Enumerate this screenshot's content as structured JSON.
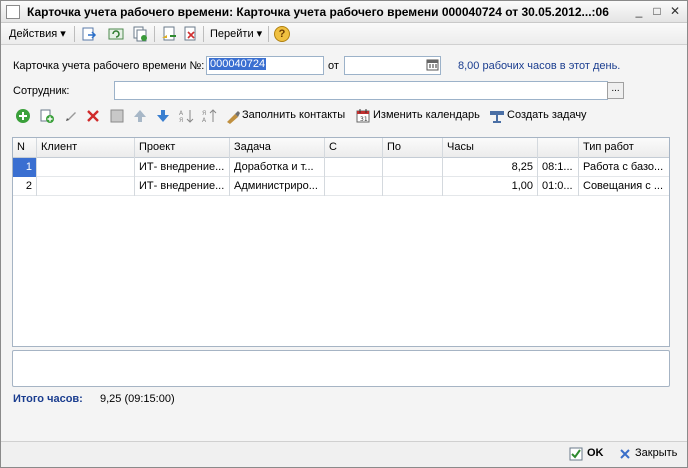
{
  "window": {
    "title": "Карточка учета рабочего времени: Карточка учета рабочего времени 000040724 от 30.05.2012...:06",
    "minimize_glyph": "_",
    "maximize_glyph": "□",
    "close_glyph": "✕"
  },
  "toolbar": {
    "actions_label": "Действия",
    "goto_label": "Перейти",
    "help_glyph": "?"
  },
  "form": {
    "card_label": "Карточка учета рабочего времени №:",
    "card_number": "000040724",
    "from_label": "от",
    "date_value": "",
    "hours_info": "8,00 рабочих часов в этот день.",
    "employee_label": "Сотрудник:",
    "employee_value": "",
    "ellipsis": "..."
  },
  "table_toolbar": {
    "fill_contacts_label": "Заполнить контакты",
    "change_calendar_label": "Изменить календарь",
    "create_task_label": "Создать задачу"
  },
  "table": {
    "columns": [
      "N",
      "Клиент",
      "Проект",
      "Задача",
      "С",
      "По",
      "Часы",
      "",
      "Тип работ"
    ],
    "rows": [
      {
        "n": "1",
        "client": "",
        "project": "ИТ- внедрение...",
        "task": "Доработка и т...",
        "from": "",
        "to": "",
        "hours": "8,25",
        "time": "08:1...",
        "work_type": "Работа с базо..."
      },
      {
        "n": "2",
        "client": "",
        "project": "ИТ- внедрение...",
        "task": "Администриро...",
        "from": "",
        "to": "",
        "hours": "1,00",
        "time": "01:0...",
        "work_type": "Совещания с ..."
      }
    ]
  },
  "summary": {
    "total_label": "Итого часов:",
    "total_value": "9,25 (09:15:00)"
  },
  "footer": {
    "ok_label": "OK",
    "close_label": "Закрыть"
  },
  "colors": {
    "accent_blue": "#1a3d8f",
    "selected_cell": "#3a6fd1"
  }
}
